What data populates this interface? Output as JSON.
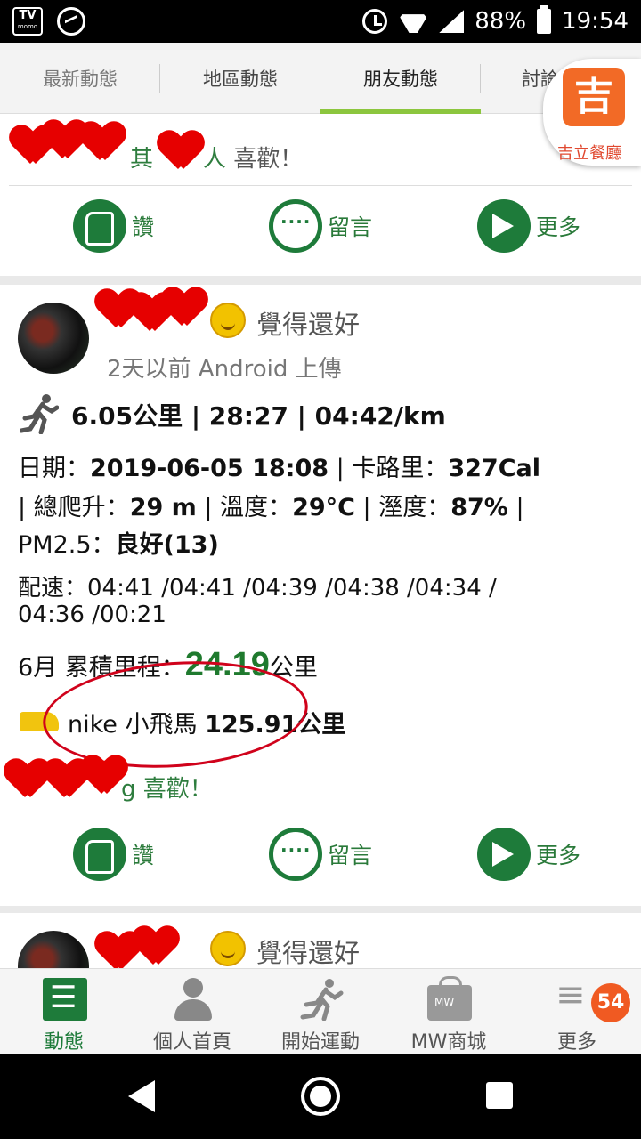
{
  "status_bar": {
    "tv_label": "TV",
    "tv_sub": "momo",
    "battery": "88%",
    "time": "19:54"
  },
  "tabs": [
    "最新動態",
    "地區動態",
    "朋友動態",
    "討論"
  ],
  "promo_badge": {
    "logo_char": "吉",
    "label": "吉立餐廳"
  },
  "card1": {
    "likes_prefix": "其",
    "likes_mid": "人",
    "likes_suffix": "喜歡！"
  },
  "actions": {
    "like": "讚",
    "comment": "留言",
    "more": "更多"
  },
  "card2": {
    "mood": "覺得還好",
    "meta": "2天以前 Android 上傳",
    "summary": "6.05公里 | 28:27 | 04:42/km",
    "detail_l1_label1": "日期：",
    "detail_l1_val1": "2019-06-05 18:08",
    "detail_l1_label2": " | 卡路里：",
    "detail_l1_val2": "327Cal",
    "detail_l2_label1": "| 總爬升：",
    "detail_l2_val1": "29 m",
    "detail_l2_label2": " | 溫度：",
    "detail_l2_val2": "29°C",
    "detail_l2_label3": " | 溼度：",
    "detail_l2_val3": "87%",
    "detail_l2_end": " |",
    "detail_l3_label": "PM2.5：",
    "detail_l3_val": "良好(13)",
    "pace_l1": "配速：04:41 /04:41 /04:39 /04:38 /04:34 /",
    "pace_l2": "04:36 /00:21",
    "month_prefix": "6月 累積里程：",
    "month_value": "24.19",
    "month_unit": "公里",
    "shoe_name": "nike 小飛馬 ",
    "shoe_km": "125.91",
    "shoe_unit": "公里",
    "likes_suffix": "g 喜歡！"
  },
  "card3": {
    "mood": "覺得還好"
  },
  "bottom_nav": [
    {
      "label": "動態"
    },
    {
      "label": "個人首頁"
    },
    {
      "label": "開始運動"
    },
    {
      "label": "MW商城"
    },
    {
      "label": "更多"
    }
  ],
  "notifications_count": "54"
}
